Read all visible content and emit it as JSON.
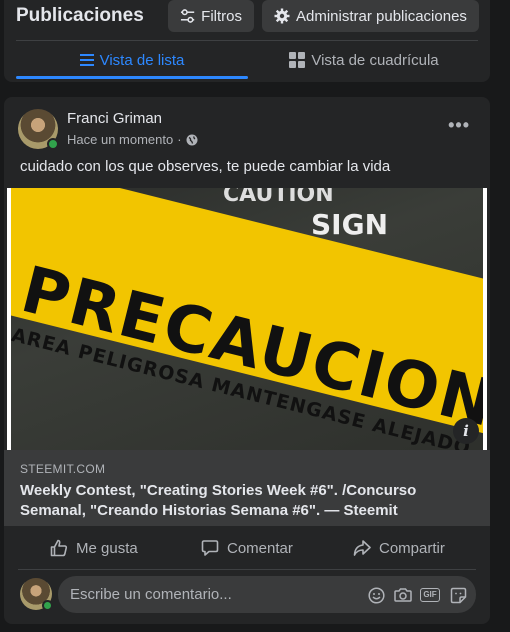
{
  "header": {
    "title": "Publicaciones",
    "filters_label": "Filtros",
    "manage_label": "Administrar publicaciones"
  },
  "tabs": [
    {
      "label": "Vista de lista",
      "active": true
    },
    {
      "label": "Vista de cuadrícula",
      "active": false
    }
  ],
  "post": {
    "author": "Franci Griman",
    "timestamp": "Hace un momento",
    "separator": "·",
    "privacy_icon": "globe-icon",
    "more_label": "•••",
    "text": "cuidado con los que observes, te puede cambiar la vida",
    "image": {
      "caution_text": "CAUTION",
      "sign_text": "SIGN",
      "tape_main": "PRECAUCION",
      "tape_sub": "AREA PELIGROSA MANTENGASE ALEJADO",
      "info_label": "i"
    },
    "link": {
      "domain": "STEEMIT.COM",
      "title": "Weekly Contest, \"Creating Stories Week #6\". /Concurso Semanal, \"Creando Historias Semana #6\". — Steemit"
    },
    "actions": {
      "like": "Me gusta",
      "comment": "Comentar",
      "share": "Compartir"
    },
    "comment_placeholder": "Escribe un comentario..."
  },
  "colors": {
    "background": "#18191a",
    "card": "#242526",
    "accent": "#2d88ff",
    "online": "#31a24c"
  }
}
